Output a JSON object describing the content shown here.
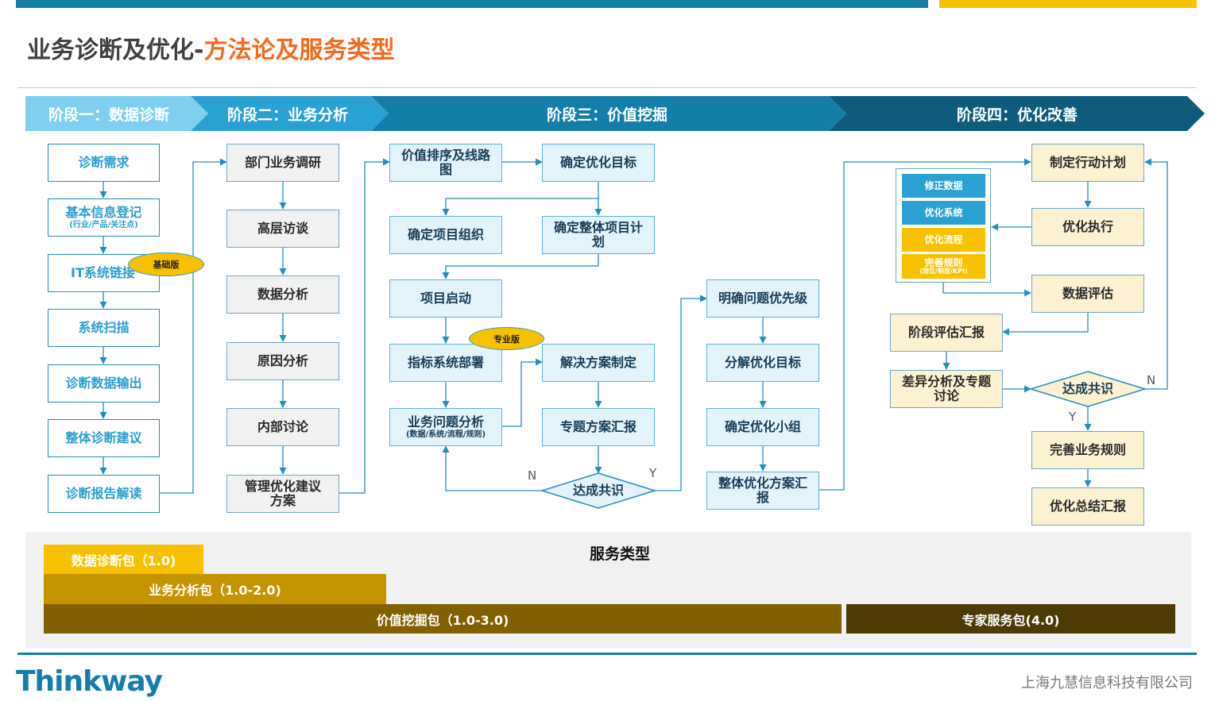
{
  "title": {
    "part1": "业务诊断及优化-",
    "part2": "方法论及服务类型"
  },
  "colors": {
    "primary_blue": "#137ea8",
    "accent_orange": "#f56a1e",
    "accent_yellow": "#f7c100"
  },
  "phases": [
    {
      "label": "阶段一：数据诊断",
      "color": "#7fcfef"
    },
    {
      "label": "阶段二：业务分析",
      "color": "#2aa1d3"
    },
    {
      "label": "阶段三：价值挖掘",
      "color": "#137ea8"
    },
    {
      "label": "阶段四：优化改善",
      "color": "#0f5b7c"
    }
  ],
  "stage1": {
    "steps": [
      "诊断需求",
      "基本信息登记",
      "IT系统链接",
      "系统扫描",
      "诊断数据输出",
      "整体诊断建议",
      "诊断报告解读"
    ],
    "step2_sub": "(行业/产品/关注点)",
    "tag": "基础版"
  },
  "stage2": {
    "steps": [
      "部门业务调研",
      "高层访谈",
      "数据分析",
      "原因分析",
      "内部讨论",
      "管理优化建议方案"
    ]
  },
  "stage3": {
    "ranking": "价值排序及线路图",
    "goal": "确定优化目标",
    "org": "确定项目组织",
    "plan": "确定整体项目计划",
    "kickoff": "项目启动",
    "deploy": "指标系统部署",
    "analysis": "业务问题分析",
    "analysis_sub": "(数据/系统/流程/规则)",
    "solution": "解决方案制定",
    "report": "专题方案汇报",
    "decision": "达成共识",
    "no_label": "N",
    "yes_label": "Y",
    "tag": "专业版",
    "priority": "明确问题优先级",
    "decompose": "分解优化目标",
    "team": "确定优化小组",
    "overall_report": "整体优化方案汇报"
  },
  "stage4": {
    "fixes": [
      {
        "label": "修正数据",
        "color": "#2aa1d3"
      },
      {
        "label": "优化系统",
        "color": "#2aa1d3"
      },
      {
        "label": "优化流程",
        "color": "#f7c100"
      },
      {
        "label": "完善规则",
        "color": "#f7c100"
      }
    ],
    "fix4_sub": "(岗位/制度/KPI)",
    "action_plan": "制定行动计划",
    "execute": "优化执行",
    "evaluate": "数据评估",
    "stage_report": "阶段评估汇报",
    "gap": "差异分析及专题讨论",
    "decision": "达成共识",
    "no_label": "N",
    "yes_label": "Y",
    "rules": "完善业务规则",
    "summary": "优化总结汇报"
  },
  "services": {
    "title": "服务类型",
    "packs": [
      {
        "label": "数据诊断包（1.0)",
        "color": "#f7c100"
      },
      {
        "label": "业务分析包（1.0-2.0)",
        "color": "#c49300"
      },
      {
        "label": "价值挖掘包（1.0-3.0)",
        "color": "#826000"
      },
      {
        "label": "专家服务包(4.0)",
        "color": "#4d3a04"
      }
    ]
  },
  "footer": {
    "logo": "Thinkway",
    "company": "上海九慧信息科技有限公司"
  }
}
